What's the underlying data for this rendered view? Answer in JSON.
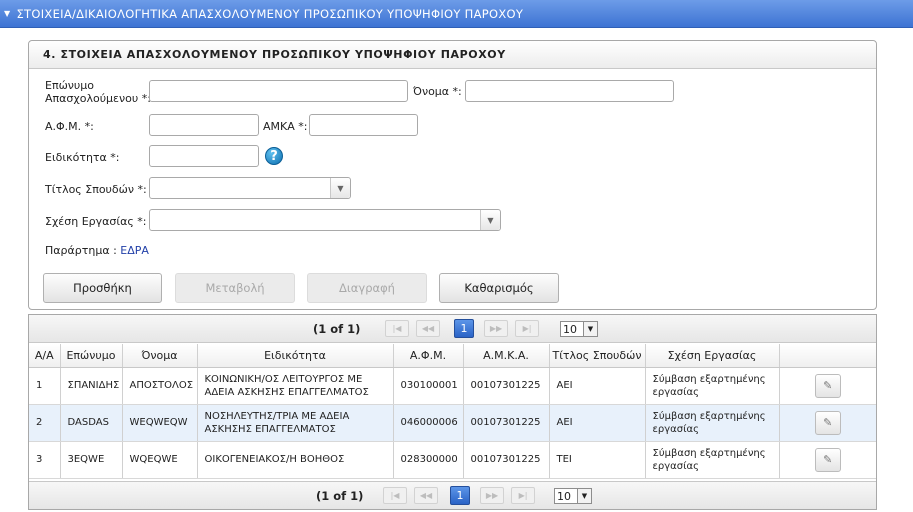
{
  "header": {
    "title": "ΣΤΟΙΧΕΙΑ/ΔΙΚΑΙΟΛΟΓΗΤΙΚΑ ΑΠΑΣΧΟΛΟΥΜΕΝΟΥ ΠΡΟΣΩΠΙΚΟΥ ΥΠΟΨΗΦΙΟΥ ΠΑΡΟΧΟΥ",
    "arrow": "▼"
  },
  "form": {
    "title": "4. ΣΤΟΙΧΕΙΑ ΑΠΑΣΧΟΛΟΥΜΕΝΟΥ ΠΡΟΣΩΠΙΚΟΥ ΥΠΟΨΗΦΙΟΥ ΠΑΡΟΧΟΥ",
    "surname_label_1": "Επώνυμο",
    "surname_label_2": "Απασχολούμενου *:",
    "surname_value": "",
    "name_label": "Όνομα *:",
    "name_value": "",
    "afm_label": "Α.Φ.Μ. *:",
    "afm_value": "",
    "amka_label": "ΑΜΚΑ *:",
    "amka_value": "",
    "specialty_label": "Ειδικότητα *:",
    "specialty_value": "",
    "help_glyph": "?",
    "degree_label": "Τίτλος Σπουδών *:",
    "degree_value": "",
    "relation_label": "Σχέση Εργασίας *:",
    "relation_value": "",
    "branch_label": "Παράρτημα :",
    "branch_value": "ΕΔΡΑ"
  },
  "buttons": {
    "add": "Προσθήκη",
    "modify": "Μεταβολή",
    "delete": "Διαγραφή",
    "clear": "Καθαρισμός"
  },
  "pager": {
    "info": "(1 of 1)",
    "page": "1",
    "rows_per_page": "10"
  },
  "table": {
    "columns": [
      "Α/Α",
      "Επώνυμο",
      "Όνομα",
      "Ειδικότητα",
      "Α.Φ.Μ.",
      "Α.Μ.Κ.Α.",
      "Τίτλος Σπουδών",
      "Σχέση Εργασίας",
      ""
    ],
    "rows": [
      {
        "aa": "1",
        "surname": "ΣΠΑΝΙΔΗΣ",
        "name": "ΑΠΟΣΤΟΛΟΣ",
        "specialty": "ΚΟΙΝΩΝΙΚΗ/ΟΣ ΛΕΙΤΟΥΡΓΟΣ ΜΕ ΑΔΕΙΑ ΑΣΚΗΣΗΣ ΕΠΑΓΓΕΛΜΑΤΟΣ",
        "afm": "030100001",
        "amka": "00107301225",
        "degree": "ΑΕΙ",
        "relation": "Σύμβαση εξαρτημένης εργασίας"
      },
      {
        "aa": "2",
        "surname": "DASDAS",
        "name": "WEQWEQW",
        "specialty": "ΝΟΣΗΛΕΥΤΗΣ/ΤΡΙΑ ΜΕ ΑΔΕΙΑ ΑΣΚΗΣΗΣ ΕΠΑΓΓΕΛΜΑΤΟΣ",
        "afm": "046000006",
        "amka": "00107301225",
        "degree": "ΑΕΙ",
        "relation": "Σύμβαση εξαρτημένης εργασίας"
      },
      {
        "aa": "3",
        "surname": "3EQWE",
        "name": "WQEQWE",
        "specialty": "ΟΙΚΟΓΕΝΕΙΑΚΟΣ/Η ΒΟΗΘΟΣ",
        "afm": "028300000",
        "amka": "00107301225",
        "degree": "ΤΕΙ",
        "relation": "Σύμβαση εξαρτημένης εργασίας"
      }
    ]
  },
  "colors": {
    "header_blue": "#3d73d3",
    "link": "#2240a8",
    "selected_page": "#2a63c6",
    "alt_row": "#e8f1fb"
  }
}
